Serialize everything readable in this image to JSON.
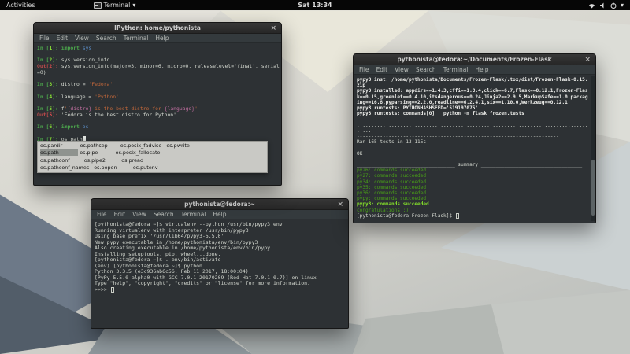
{
  "ui": {
    "close_glyph": "×",
    "chevron_glyph": "▾"
  },
  "colors": {
    "terminal_bg": "#2d3134",
    "terminal_fg": "#d3d7cf",
    "prompt_green": "#4ca64c",
    "out_red": "#b94a4a",
    "string_orange": "#c4683a",
    "module_blue": "#5b8fc9",
    "summary_green": "#49a017",
    "popup_bg": "#c9c9c5",
    "topbar_bg": "#060606"
  },
  "topbar": {
    "activities_label": "Activities",
    "app_name": "Terminal",
    "clock": "Sat 13:34"
  },
  "windows": {
    "ipython": {
      "title": "IPython: home/pythonista",
      "menu": [
        "File",
        "Edit",
        "View",
        "Search",
        "Terminal",
        "Help"
      ],
      "lines": [
        [
          {
            "t": "In [",
            "c": "grn"
          },
          {
            "t": "1",
            "c": "lim"
          },
          {
            "t": "]: ",
            "c": "grn"
          },
          {
            "t": "import ",
            "c": "grn"
          },
          {
            "t": "sys",
            "c": "blu"
          }
        ],
        [],
        [
          {
            "t": "In [",
            "c": "grn"
          },
          {
            "t": "2",
            "c": "lim"
          },
          {
            "t": "]: ",
            "c": "grn"
          },
          {
            "t": "sys.version_info"
          }
        ],
        [
          {
            "t": "Out[",
            "c": "red"
          },
          {
            "t": "2",
            "c": "brd"
          },
          {
            "t": "]: ",
            "c": "red"
          },
          {
            "t": "sys.version_info(major=3, minor=6, micro=0, releaselevel='final', serial"
          }
        ],
        [
          {
            "t": "=0)"
          }
        ],
        [],
        [
          {
            "t": "In [",
            "c": "grn"
          },
          {
            "t": "3",
            "c": "lim"
          },
          {
            "t": "]: ",
            "c": "grn"
          },
          {
            "t": "distro = "
          },
          {
            "t": "'Fedora'",
            "c": "org"
          }
        ],
        [],
        [
          {
            "t": "In [",
            "c": "grn"
          },
          {
            "t": "4",
            "c": "lim"
          },
          {
            "t": "]: ",
            "c": "grn"
          },
          {
            "t": "language = "
          },
          {
            "t": "'Python'",
            "c": "org"
          }
        ],
        [],
        [
          {
            "t": "In [",
            "c": "grn"
          },
          {
            "t": "5",
            "c": "lim"
          },
          {
            "t": "]: ",
            "c": "grn"
          },
          {
            "t": "f"
          },
          {
            "t": "'",
            "c": "org"
          },
          {
            "t": "{distro}",
            "c": "mag"
          },
          {
            "t": " is the best distro for ",
            "c": "org"
          },
          {
            "t": "{language}",
            "c": "mag"
          },
          {
            "t": "'",
            "c": "org"
          }
        ],
        [
          {
            "t": "Out[",
            "c": "red"
          },
          {
            "t": "5",
            "c": "brd"
          },
          {
            "t": "]: ",
            "c": "red"
          },
          {
            "t": "'Fedora is the best distro for Python'"
          }
        ],
        [],
        [
          {
            "t": "In [",
            "c": "grn"
          },
          {
            "t": "6",
            "c": "lim"
          },
          {
            "t": "]: ",
            "c": "grn"
          },
          {
            "t": "import ",
            "c": "grn"
          },
          {
            "t": "os",
            "c": "blu"
          }
        ],
        [],
        [
          {
            "t": "In [",
            "c": "grn"
          },
          {
            "t": "7",
            "c": "lim"
          },
          {
            "t": "]: ",
            "c": "grn"
          },
          {
            "t": "os.path"
          },
          {
            "t": " ",
            "c": "cur"
          }
        ]
      ],
      "popup_rows": [
        [
          {
            "t": "os.pardir           os.pathsep        os.posix_fadvise   os.pwrite"
          }
        ],
        [
          {
            "t": "os.path",
            "c": "sel"
          },
          {
            "t": "             os.pipe           os.posix_fallocate"
          }
        ],
        [
          {
            "t": "os.pathconf         os.pipe2          os.pread"
          }
        ],
        [
          {
            "t": "os.pathconf_names   os.popen          os.putenv"
          }
        ]
      ]
    },
    "local": {
      "title": "pythonista@fedora:~",
      "menu": [
        "File",
        "Edit",
        "View",
        "Search",
        "Terminal",
        "Help"
      ],
      "lines": [
        [
          {
            "t": "[pythonista@fedora ~]$ virtualenv --python /usr/bin/pypy3 env"
          }
        ],
        [
          {
            "t": "Running virtualenv with interpreter /usr/bin/pypy3"
          }
        ],
        [
          {
            "t": "Using base prefix '/usr/lib64/pypy3-5.5.0'"
          }
        ],
        [
          {
            "t": "New pypy executable in /home/pythonista/env/bin/pypy3"
          }
        ],
        [
          {
            "t": "Also creating executable in /home/pythonista/env/bin/pypy"
          }
        ],
        [
          {
            "t": "Installing setuptools, pip, wheel...done."
          }
        ],
        [
          {
            "t": "[pythonista@fedora ~]$ . env/bin/activate"
          }
        ],
        [
          {
            "t": "(env) [pythonista@fedora ~]$ python"
          }
        ],
        [
          {
            "t": "Python 3.3.5 (e3c936ab6c56, Feb 11 2017, 18:00:04)"
          }
        ],
        [
          {
            "t": "[PyPy 5.5.0-alpha0 with GCC 7.0.1 20170209 (Red Hat 7.0.1-0.7)] on linux"
          }
        ],
        [
          {
            "t": "Type \"help\", \"copyright\", \"credits\" or \"license\" for more information."
          }
        ],
        [
          {
            "t": ">>>> "
          },
          {
            "t": " ",
            "c": "hcur"
          }
        ]
      ]
    },
    "tox": {
      "title": "pythonista@fedora:~/Documents/Frozen-Flask",
      "menu": [
        "File",
        "Edit",
        "View",
        "Search",
        "Terminal",
        "Help"
      ],
      "lines": [
        [
          {
            "t": "pypy3 inst: /home/pythonista/Documents/Frozen-Flask/.tox/dist/Frozen-Flask-0.15.",
            "c": "bld"
          }
        ],
        [
          {
            "t": "zip",
            "c": "bld"
          }
        ],
        [
          {
            "t": "pypy3 installed: appdirs==1.4.3,cffi==1.8.4,click==6.7,Flask==0.12.1,Frozen-Flas",
            "c": "bld"
          }
        ],
        [
          {
            "t": "k==0.15,greenlet==0.4.10,itsdangerous==0.24,Jinja2==2.9.5,MarkupSafe==1.0,packag",
            "c": "bld"
          }
        ],
        [
          {
            "t": "ing==16.8,pyparsing==2.2.0,readline==6.2.4.1,six==1.10.0,Werkzeug==0.12.1",
            "c": "bld"
          }
        ],
        [
          {
            "t": "pypy3 runtests: PYTHONHASHSEED='519197075'",
            "c": "bld"
          }
        ],
        [
          {
            "t": "pypy3 runtests: commands[0] | python -m flask_frozen.tests",
            "c": "bld"
          }
        ],
        [
          {
            "t": "................................................................................"
          }
        ],
        [
          {
            "t": "................................................................................"
          }
        ],
        [
          {
            "t": "....."
          }
        ],
        [
          {
            "t": "----------------------------------------------------------------------"
          }
        ],
        [
          {
            "t": "Ran 165 tests in 13.115s"
          }
        ],
        [],
        [
          {
            "t": "OK"
          }
        ],
        [],
        [
          {
            "t": "__________________________________ summary ___________________________________"
          }
        ],
        [
          {
            "t": "py26: commands succeeded",
            "c": "sgr"
          }
        ],
        [
          {
            "t": "py27: commands succeeded",
            "c": "sgr"
          }
        ],
        [
          {
            "t": "py34: commands succeeded",
            "c": "sgr"
          }
        ],
        [
          {
            "t": "py35: commands succeeded",
            "c": "sgr"
          }
        ],
        [
          {
            "t": "py36: commands succeeded",
            "c": "sgr"
          }
        ],
        [
          {
            "t": "pypy: commands succeeded",
            "c": "sgr"
          }
        ],
        [
          {
            "t": "pypy3: commands succeeded",
            "c": "sgb"
          }
        ],
        [
          {
            "t": "congratulations :)",
            "c": "sgr"
          }
        ],
        [
          {
            "t": "[pythonista@fedora Frozen-Flask]$ "
          },
          {
            "t": " ",
            "c": "hcur"
          }
        ]
      ]
    }
  }
}
